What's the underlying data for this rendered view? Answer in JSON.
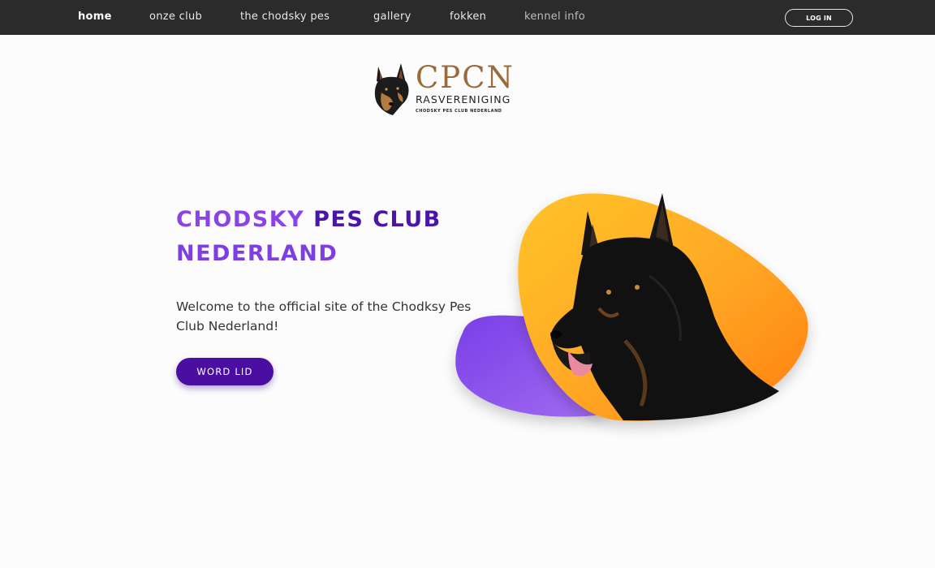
{
  "nav": {
    "items": [
      {
        "label": "home"
      },
      {
        "label": "onze club"
      },
      {
        "label": "the chodsky pes"
      },
      {
        "label": "gallery"
      },
      {
        "label": "fokken"
      },
      {
        "label": "kennel info"
      }
    ],
    "login_label": "LOG IN"
  },
  "logo": {
    "main": "CPCN",
    "sub": "RASVERENIGING",
    "tiny": "CHODSKY PES CLUB NEDERLAND"
  },
  "hero": {
    "title_words": [
      "CHODSKY",
      "PES",
      "CLUB",
      "NEDERLAND"
    ],
    "text": "Welcome to the official site of the Chodksy Pes Club Nederland!",
    "cta_label": "WORD LID"
  },
  "colors": {
    "nav_bg": "#2b2b2b",
    "purple_light": "#8a44e6",
    "purple_dark": "#4a15a8",
    "cta_bg": "#4a0fa0",
    "orange": "#ff9a1f",
    "logo_brown": "#9a6a3a"
  },
  "icons": {
    "logo_mark": "dog-head-icon"
  }
}
